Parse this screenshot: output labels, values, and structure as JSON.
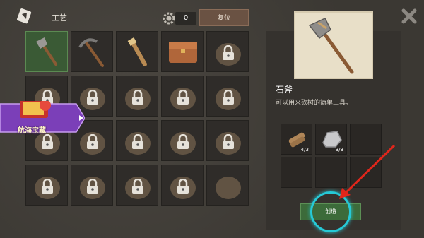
{
  "header": {
    "title": "工艺",
    "count": "0",
    "reset_label": "复位",
    "gear_icon": "gear-icon",
    "craft_icon": "crafting-icon"
  },
  "promo": {
    "label": "航海宝藏",
    "colors": {
      "banner": "#7b3fb8",
      "text": "#fff6c8"
    }
  },
  "grid": {
    "items": [
      {
        "name": "stone-axe",
        "locked": false,
        "selected": true
      },
      {
        "name": "pickaxe",
        "locked": false
      },
      {
        "name": "torch",
        "locked": false
      },
      {
        "name": "wooden-chest",
        "locked": false
      },
      {
        "name": "campfire",
        "locked": true
      },
      {
        "name": "backpack",
        "locked": true
      },
      {
        "name": "backpack-2",
        "locked": true
      },
      {
        "name": "trap",
        "locked": true
      },
      {
        "name": "roof-frame",
        "locked": true
      },
      {
        "name": "tripod",
        "locked": true
      },
      {
        "name": "barrel",
        "locked": true
      },
      {
        "name": "plant-pot",
        "locked": true
      },
      {
        "name": "sapling",
        "locked": true
      },
      {
        "name": "meat-rack",
        "locked": true
      },
      {
        "name": "axe-2",
        "locked": true
      },
      {
        "name": "hood",
        "locked": true
      },
      {
        "name": "shirt",
        "locked": true
      },
      {
        "name": "pants",
        "locked": true
      },
      {
        "name": "boots",
        "locked": true
      },
      {
        "name": "armor",
        "locked": false
      }
    ]
  },
  "detail": {
    "name": "石斧",
    "description": "可以用来砍树的简单工具。",
    "ingredients": [
      {
        "icon": "wood-log-icon",
        "count": "4/3"
      },
      {
        "icon": "stone-icon",
        "count": "3/3"
      }
    ],
    "create_label": "创造"
  },
  "colors": {
    "accent_green": "#3c6b3a",
    "highlight": "#26c9d6",
    "arrow": "#e0261b"
  }
}
